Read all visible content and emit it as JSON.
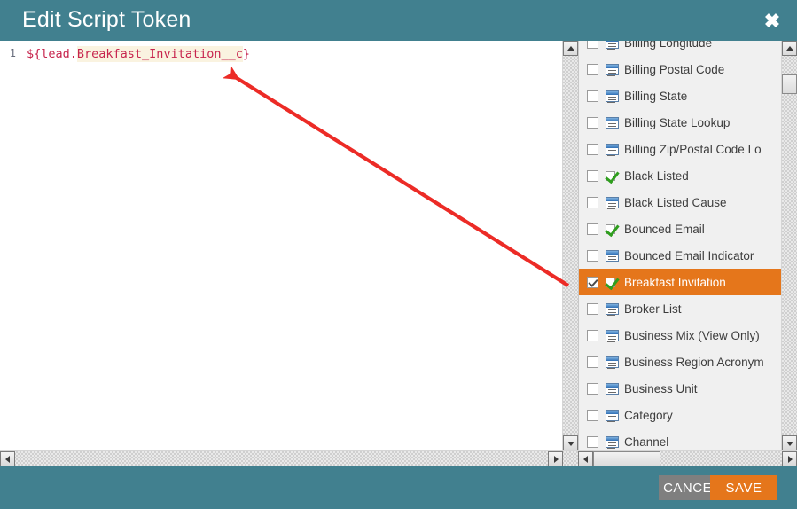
{
  "header": {
    "title": "Edit Script Token",
    "close_label": "✖"
  },
  "editor": {
    "line_number": "1",
    "code_prefix": "${lead.",
    "code_highlight": "Breakfast_Invitation__c",
    "code_suffix": "}",
    "full_code": "${lead.Breakfast_Invitation__c}"
  },
  "field_list": {
    "items": [
      {
        "label": "Billing Longitude",
        "icon": "text-field-icon",
        "checked": false,
        "selected": false
      },
      {
        "label": "Billing Postal Code",
        "icon": "text-field-icon",
        "checked": false,
        "selected": false
      },
      {
        "label": "Billing State",
        "icon": "text-field-icon",
        "checked": false,
        "selected": false
      },
      {
        "label": "Billing State Lookup",
        "icon": "text-field-icon",
        "checked": false,
        "selected": false
      },
      {
        "label": "Billing Zip/Postal Code Lo",
        "icon": "text-field-icon",
        "checked": false,
        "selected": false
      },
      {
        "label": "Black Listed",
        "icon": "checkbox-field-icon",
        "checked": false,
        "selected": false
      },
      {
        "label": "Black Listed Cause",
        "icon": "text-field-icon",
        "checked": false,
        "selected": false
      },
      {
        "label": "Bounced Email",
        "icon": "checkbox-field-icon",
        "checked": false,
        "selected": false
      },
      {
        "label": "Bounced Email Indicator",
        "icon": "text-field-icon",
        "checked": false,
        "selected": false
      },
      {
        "label": "Breakfast Invitation",
        "icon": "checkbox-field-icon",
        "checked": true,
        "selected": true
      },
      {
        "label": "Broker List",
        "icon": "text-field-icon",
        "checked": false,
        "selected": false
      },
      {
        "label": "Business Mix (View Only)",
        "icon": "text-field-icon",
        "checked": false,
        "selected": false
      },
      {
        "label": "Business Region Acronym",
        "icon": "text-field-icon",
        "checked": false,
        "selected": false
      },
      {
        "label": "Business Unit",
        "icon": "text-field-icon",
        "checked": false,
        "selected": false
      },
      {
        "label": "Category",
        "icon": "text-field-icon",
        "checked": false,
        "selected": false
      },
      {
        "label": "Channel",
        "icon": "text-field-icon",
        "checked": false,
        "selected": false
      }
    ]
  },
  "footer": {
    "cancel_label": "CANCEL",
    "save_label": "SAVE"
  },
  "colors": {
    "header_teal": "#41808f",
    "accent_orange": "#e5761b",
    "cancel_gray": "#7f7f7f",
    "code_crimson": "#c7254e",
    "code_highlight_bg": "#faf3e0",
    "annotation_red": "#ec2b26"
  }
}
